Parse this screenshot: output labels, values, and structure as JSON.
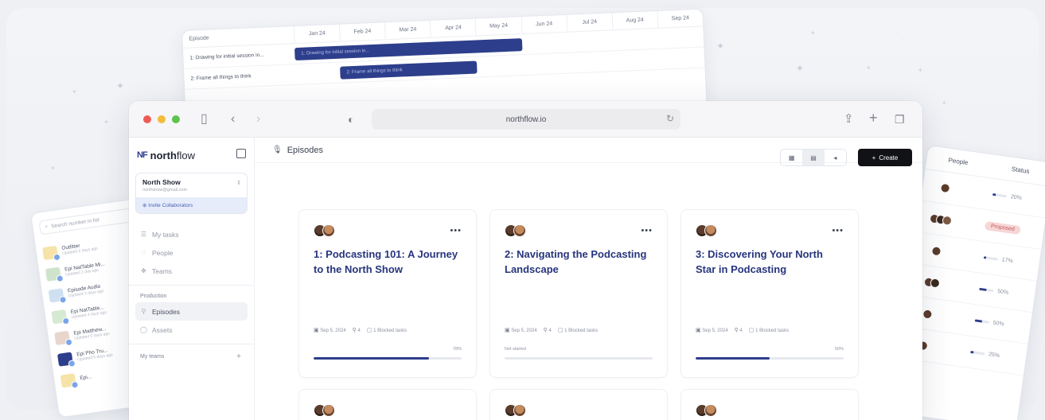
{
  "timeline": {
    "first_col": "Episode",
    "months": [
      "Jan 24",
      "Feb 24",
      "Mar 24",
      "Apr 24",
      "May 24",
      "Jun 24",
      "Jul 24",
      "Aug 24",
      "Sep 24"
    ],
    "rows": [
      {
        "name": "1: Drawing for initial session in...",
        "bar": "1: Drawing for initial session in..."
      },
      {
        "name": "2: Frame all things to think",
        "bar": "2: Frame all things to think"
      }
    ]
  },
  "left_panel": {
    "search_placeholder": "Search number in list",
    "items": [
      {
        "title": "Outfitter",
        "sub": "Updated 2 days ago",
        "color": "#f5e3a8"
      },
      {
        "title": "Epi NatTable Mi...",
        "sub": "Updated 1 day ago",
        "color": "#cfe3cc"
      },
      {
        "title": "Episode Audio",
        "sub": "Updated 3 days ago",
        "color": "#cfe0f2"
      },
      {
        "title": "Epi NatTable...",
        "sub": "Updated 4 days ago",
        "color": "#d5ead1"
      },
      {
        "title": "Epi Matthew...",
        "sub": "Updated 5 days ago",
        "color": "#e8d6cc"
      },
      {
        "title": "Epi Pho Tru...",
        "sub": "Updated 6 days ago",
        "color": "#2d3e8c"
      },
      {
        "title": "Epi...",
        "sub": "",
        "color": "#f5e3a8"
      }
    ]
  },
  "right_panel": {
    "col_people": "People",
    "col_status": "Status",
    "rows": [
      {
        "status": "20%",
        "value": 0.2
      },
      {
        "status": "Proposed",
        "value": null
      },
      {
        "status": "17%",
        "value": 0.17
      },
      {
        "status": "50%",
        "value": 0.5
      },
      {
        "status": "50%",
        "value": 0.5
      },
      {
        "status": "25%",
        "value": 0.25
      }
    ]
  },
  "browser": {
    "url": "northflow.io"
  },
  "sidebar": {
    "brand_mark": "NF",
    "brand_name_bold": "north",
    "brand_name_rest": "flow",
    "workspace_name": "North Show",
    "workspace_email": "northshow@gmail.com",
    "invite_label": "Invite Collaborators",
    "nav": [
      {
        "label": "My tasks",
        "icon": "☰"
      },
      {
        "label": "People",
        "icon": "◌"
      },
      {
        "label": "Teams",
        "icon": "✥"
      }
    ],
    "production_section": "Production",
    "production_items": [
      {
        "label": "Episodes",
        "icon": "⚲",
        "active": true
      },
      {
        "label": "Assets",
        "icon": "◯",
        "active": false
      }
    ],
    "my_teams_section": "My teams"
  },
  "main": {
    "title": "Episodes",
    "create_label": "Create",
    "cards": [
      {
        "title": "1: Podcasting 101: A Journey to the North Show",
        "date": "Sep 5, 2024",
        "attachments": "4",
        "blocked": "1 Blocked tasks",
        "progress_left": "",
        "progress_right": "78%",
        "progress": 0.78
      },
      {
        "title": "2: Navigating the Podcasting Landscape",
        "date": "Sep 5, 2024",
        "attachments": "4",
        "blocked": "1 Blocked tasks",
        "progress_left": "Not started",
        "progress_right": "",
        "progress": 0.0
      },
      {
        "title": "3: Discovering Your North Star in Podcasting",
        "date": "Sep 5, 2024",
        "attachments": "4",
        "blocked": "1 Blocked tasks",
        "progress_left": "",
        "progress_right": "50%",
        "progress": 0.5
      }
    ]
  },
  "colors": {
    "accent": "#2d3e8c",
    "title_blue": "#27357d",
    "create_bg": "#101216"
  }
}
